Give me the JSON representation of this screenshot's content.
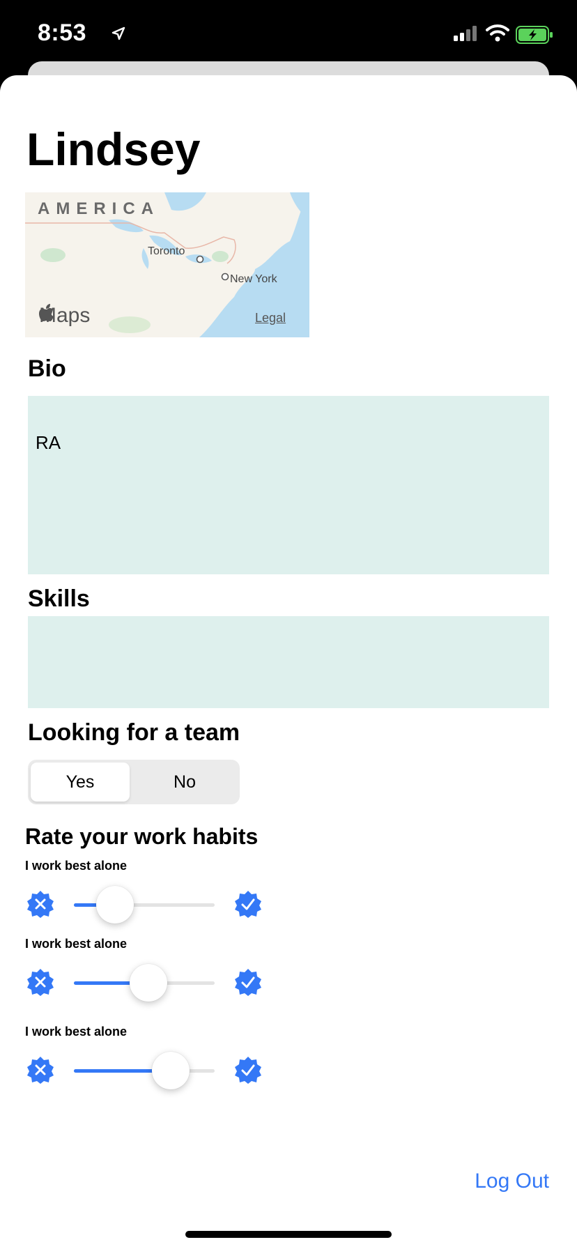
{
  "status_bar": {
    "time": "8:53"
  },
  "profile": {
    "name": "Lindsey"
  },
  "map": {
    "region_label": "AMERICA",
    "cities": [
      "Toronto",
      "New York"
    ],
    "brand": "Maps",
    "legal": "Legal"
  },
  "bio": {
    "label": "Bio",
    "value": "RA"
  },
  "skills": {
    "label": "Skills",
    "value": ""
  },
  "team": {
    "label": "Looking for a team",
    "options": [
      "Yes",
      "No"
    ],
    "selected": "Yes"
  },
  "habits": {
    "title": "Rate your work habits",
    "items": [
      {
        "label": "I work best alone",
        "value": 0.29
      },
      {
        "label": "I work best alone",
        "value": 0.53
      },
      {
        "label": "I work best alone",
        "value": 0.69
      }
    ]
  },
  "footer": {
    "logout_label": "Log Out"
  },
  "colors": {
    "accent": "#3478f6",
    "text_area_bg": "#def0ed"
  }
}
